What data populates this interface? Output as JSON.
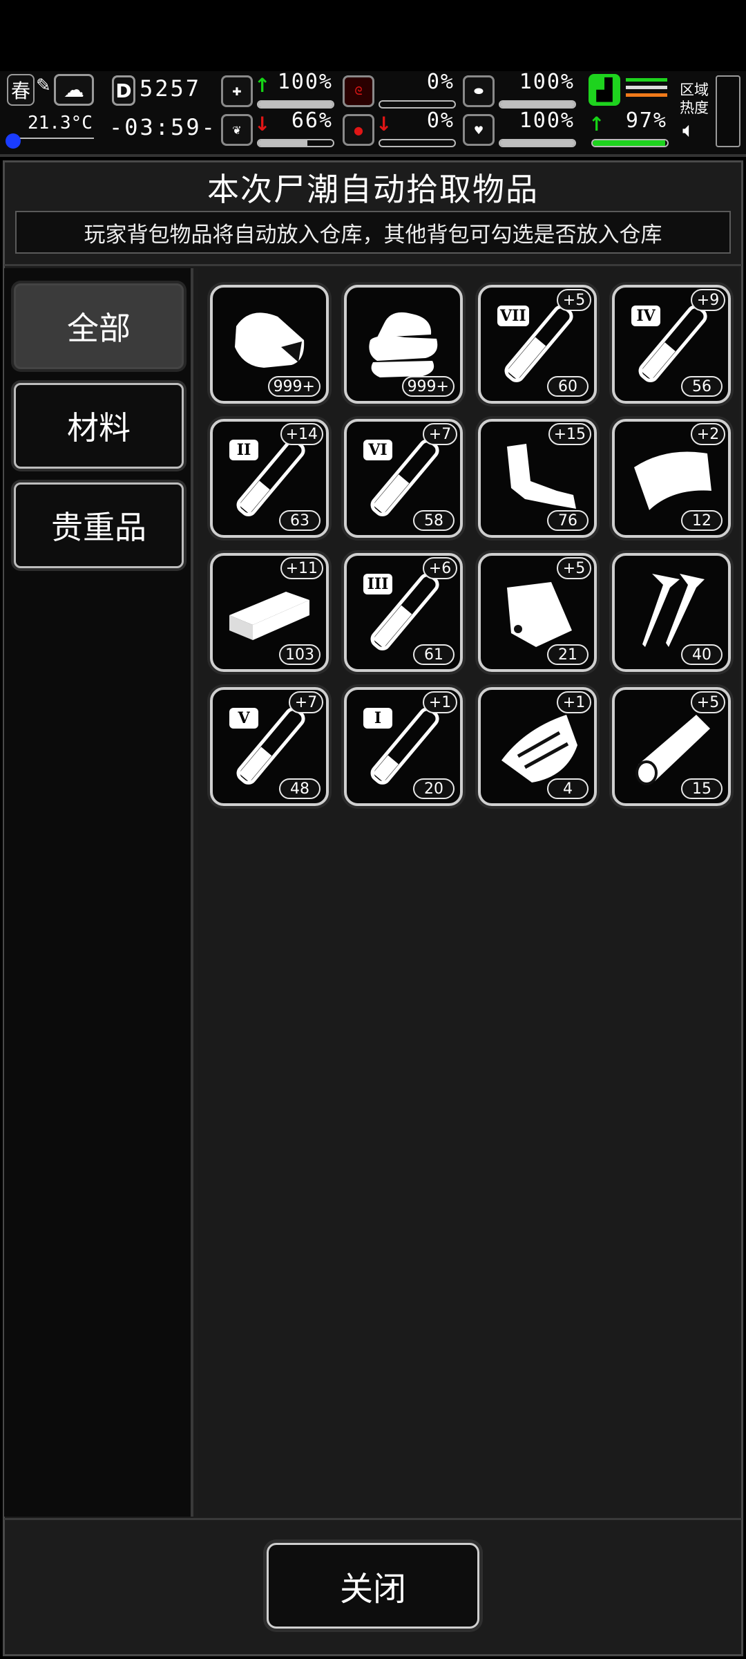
{
  "status": {
    "season": "春",
    "temperature": "21.3°C",
    "day": "5257",
    "time": "-03:59-",
    "stats": [
      {
        "id": "health",
        "value": "100%",
        "level": 1.0,
        "trend": "up"
      },
      {
        "id": "hunger",
        "value": "0%",
        "level": 0.0,
        "trend": "none"
      },
      {
        "id": "armor",
        "value": "100%",
        "level": 1.0,
        "trend": "none"
      },
      {
        "id": "sanity",
        "value": "66%",
        "level": 0.66,
        "trend": "down"
      },
      {
        "id": "bleed",
        "value": "0%",
        "level": 0.0,
        "trend": "down"
      },
      {
        "id": "heart",
        "value": "100%",
        "level": 1.0,
        "trend": "none"
      },
      {
        "id": "stamina",
        "value": "97%",
        "level": 0.97,
        "trend": "up"
      }
    ],
    "region_label": "区域\n热度",
    "region_line1": "区域",
    "region_line2": "热度"
  },
  "panel": {
    "title": "本次尸潮自动拾取物品",
    "subtitle": "玩家背包物品将自动放入仓库，其他背包可勾选是否放入仓库"
  },
  "categories": [
    {
      "label": "全部",
      "active": true
    },
    {
      "label": "材料",
      "active": false
    },
    {
      "label": "贵重品",
      "active": false
    }
  ],
  "items": [
    {
      "icon": "meat-icon",
      "qty": "999+",
      "plus": "",
      "tier": ""
    },
    {
      "icon": "cloth-icon",
      "qty": "999+",
      "plus": "",
      "tier": ""
    },
    {
      "icon": "test-tube-icon",
      "qty": "60",
      "plus": "+5",
      "tier": "VII"
    },
    {
      "icon": "test-tube-icon",
      "qty": "56",
      "plus": "+9",
      "tier": "IV"
    },
    {
      "icon": "test-tube-icon",
      "qty": "63",
      "plus": "+14",
      "tier": "II"
    },
    {
      "icon": "test-tube-icon",
      "qty": "58",
      "plus": "+7",
      "tier": "VI"
    },
    {
      "icon": "scrap-metal-icon",
      "qty": "76",
      "plus": "+15",
      "tier": ""
    },
    {
      "icon": "metal-sheet-icon",
      "qty": "12",
      "plus": "+2",
      "tier": ""
    },
    {
      "icon": "plank-icon",
      "qty": "103",
      "plus": "+11",
      "tier": ""
    },
    {
      "icon": "test-tube-icon",
      "qty": "61",
      "plus": "+6",
      "tier": "III"
    },
    {
      "icon": "plastic-bag-icon",
      "qty": "21",
      "plus": "+5",
      "tier": ""
    },
    {
      "icon": "nails-icon",
      "qty": "40",
      "plus": "",
      "tier": ""
    },
    {
      "icon": "test-tube-icon",
      "qty": "48",
      "plus": "+7",
      "tier": "V"
    },
    {
      "icon": "test-tube-icon",
      "qty": "20",
      "plus": "+1",
      "tier": "I"
    },
    {
      "icon": "wood-pieces-icon",
      "qty": "4",
      "plus": "+1",
      "tier": ""
    },
    {
      "icon": "log-icon",
      "qty": "15",
      "plus": "+5",
      "tier": ""
    }
  ],
  "footer": {
    "close_label": "关闭"
  }
}
